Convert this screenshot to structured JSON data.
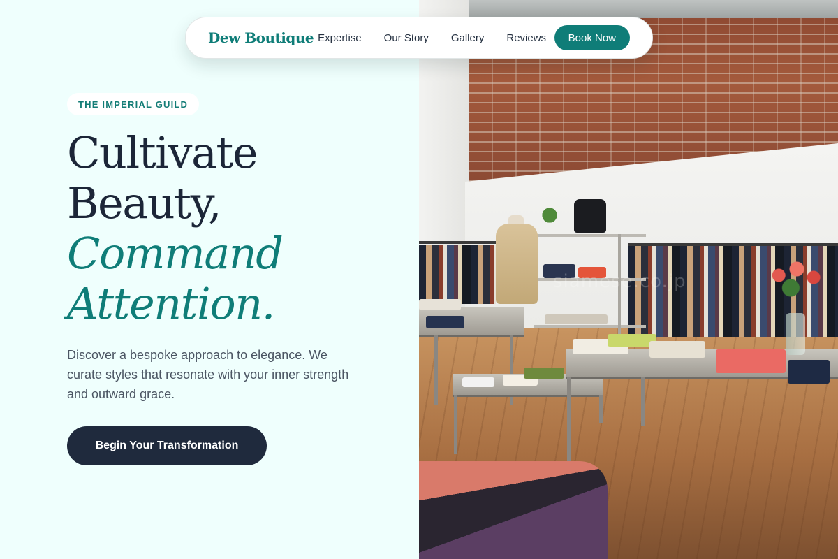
{
  "nav": {
    "brand": "Dew Boutique",
    "links": [
      "Expertise",
      "Our Story",
      "Gallery",
      "Reviews"
    ],
    "book_label": "Book Now"
  },
  "hero": {
    "badge": "THE IMPERIAL GUILD",
    "headline_line1": "Cultivate",
    "headline_line2": "Beauty,",
    "headline_accent_line1": "Command",
    "headline_accent_line2": "Attention.",
    "description": "Discover a bespoke approach to elegance. We curate styles that resonate with your inner strength and outward grace.",
    "cta_label": "Begin Your Transformation"
  },
  "photo": {
    "watermark": "siamese.co.jp"
  },
  "colors": {
    "accent": "#0f7d78",
    "navy": "#1f2a3d",
    "background": "#effffd"
  }
}
